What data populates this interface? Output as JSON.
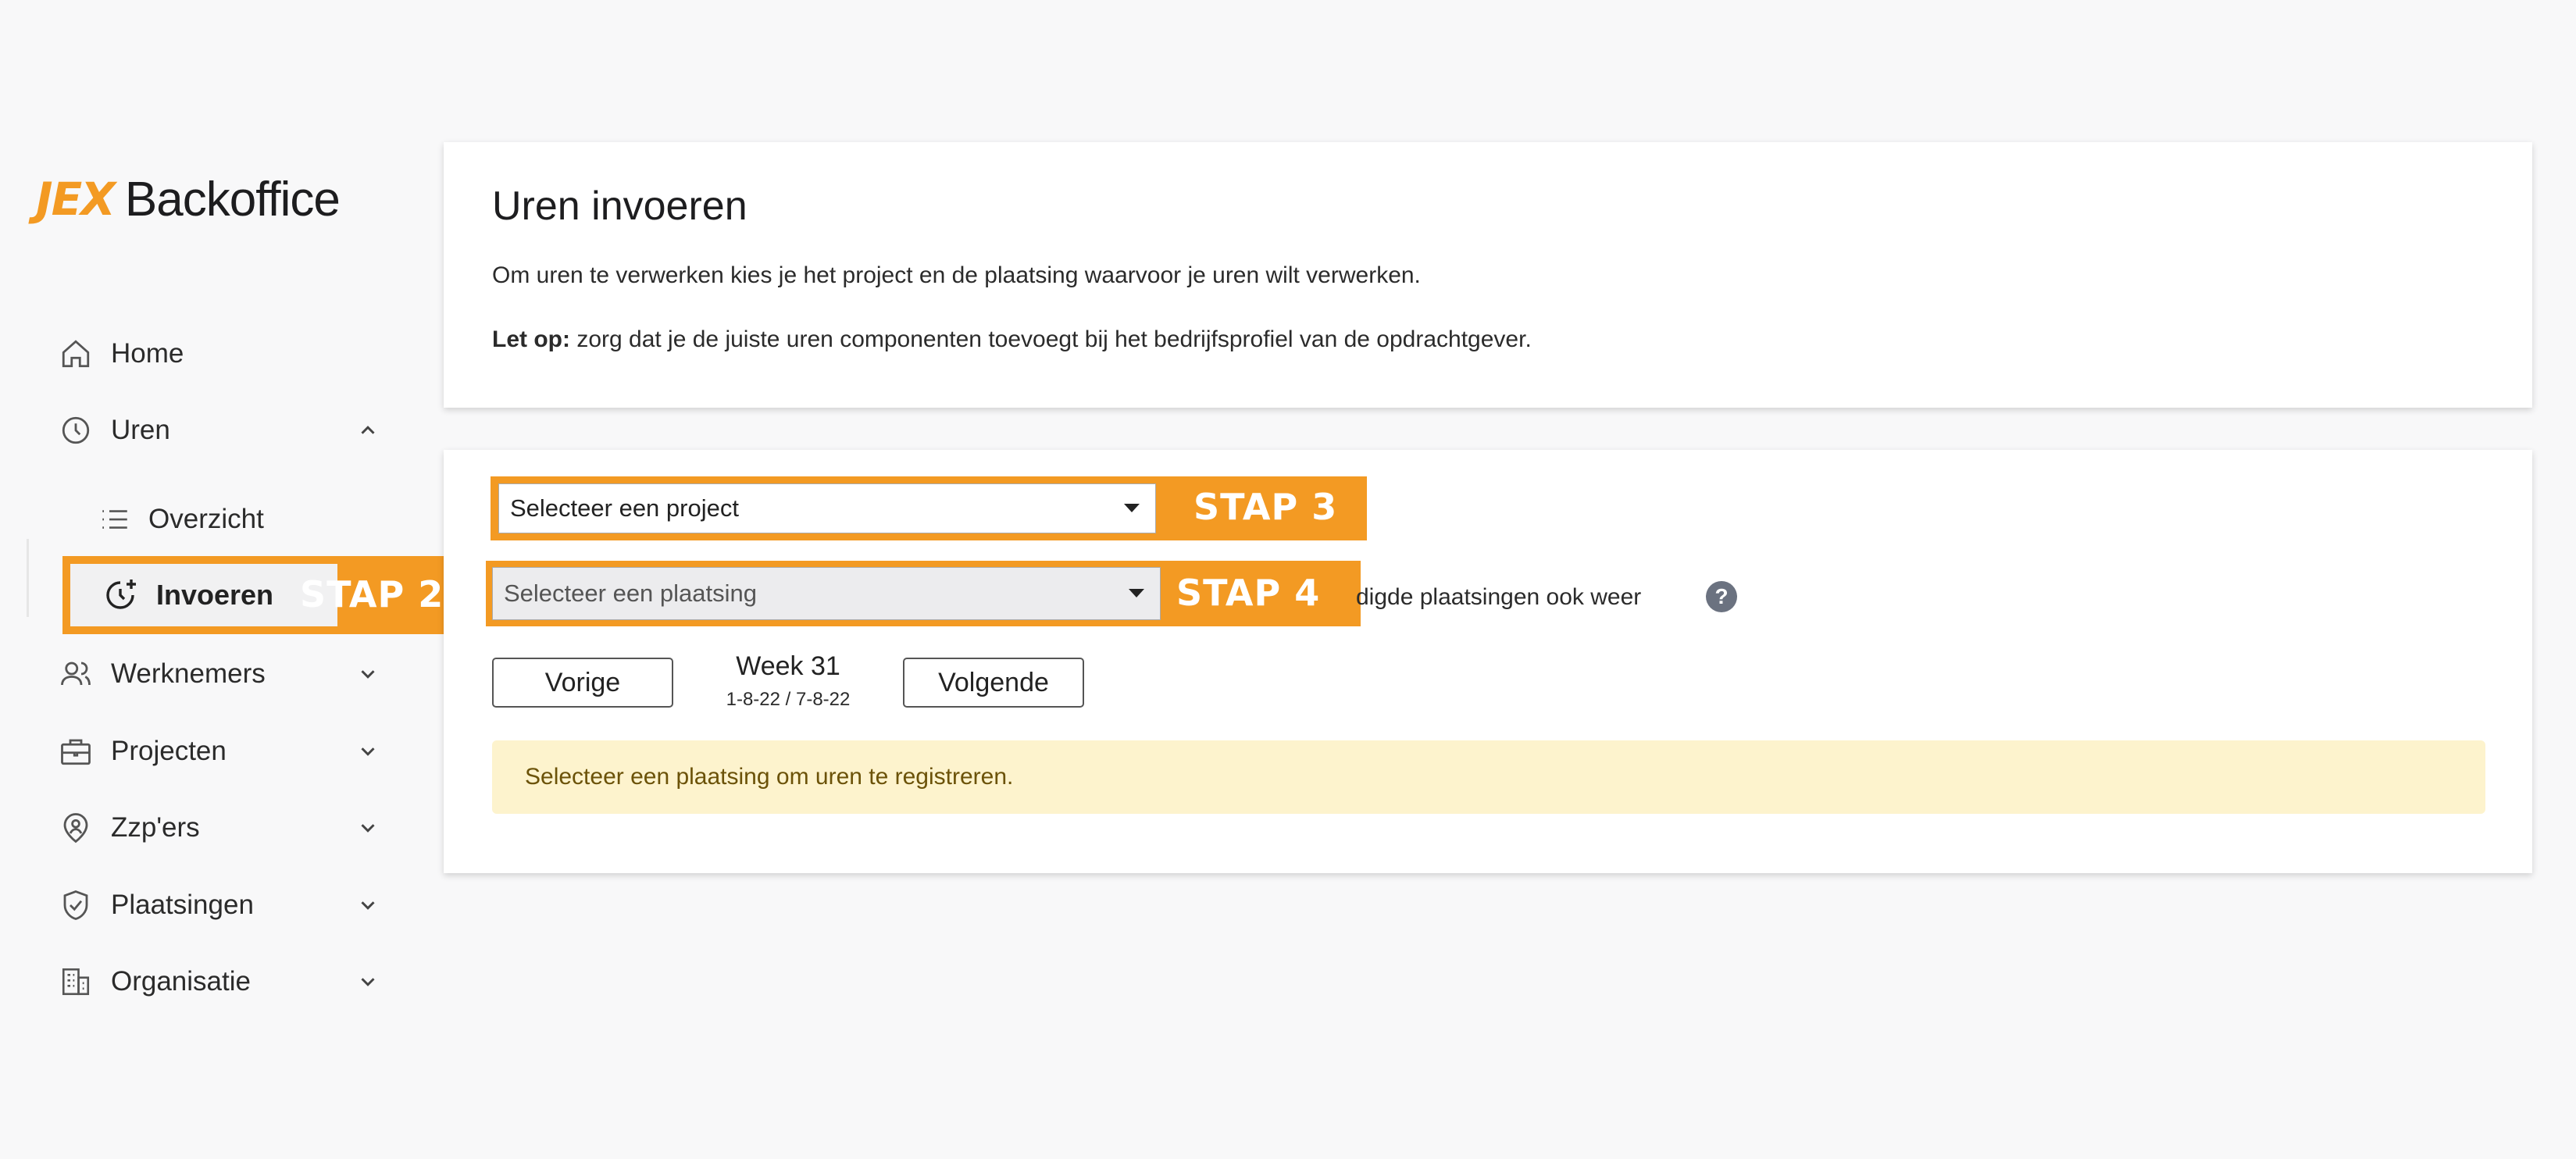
{
  "logo": {
    "mark": "JEX",
    "text": "Backoffice"
  },
  "sidebar": {
    "items": [
      {
        "label": "Home"
      },
      {
        "label": "Uren"
      },
      {
        "label": "Werknemers"
      },
      {
        "label": "Projecten"
      },
      {
        "label": "Zzp'ers"
      },
      {
        "label": "Plaatsingen"
      },
      {
        "label": "Organisatie"
      }
    ],
    "sub_items": [
      {
        "label": "Overzicht"
      },
      {
        "label": "Invoeren"
      }
    ]
  },
  "annotations": {
    "stap2": "STAP 2",
    "stap3": "STAP 3",
    "stap4": "STAP 4"
  },
  "header": {
    "title": "Uren invoeren",
    "intro": "Om uren te verwerken kies je het project en de plaatsing waarvoor je uren wilt verwerken.",
    "note_label": "Let op:",
    "note_text": " zorg dat je de juiste uren componenten toevoegt bij het bedrijfsprofiel van de opdrachtgever."
  },
  "form": {
    "project_select": "Selecteer een project",
    "plaatsing_select": "Selecteer een plaatsing",
    "checkbox_label_partial": "digde plaatsingen ook weer",
    "help": "?"
  },
  "week_nav": {
    "prev": "Vorige",
    "next": "Volgende",
    "week": "Week 31",
    "range": "1-8-22 / 7-8-22"
  },
  "alert": "Selecteer een plaatsing om uren te registreren.",
  "colors": {
    "accent": "#f39a23",
    "alert_bg": "#fdf3cd",
    "alert_text": "#6b5208"
  }
}
